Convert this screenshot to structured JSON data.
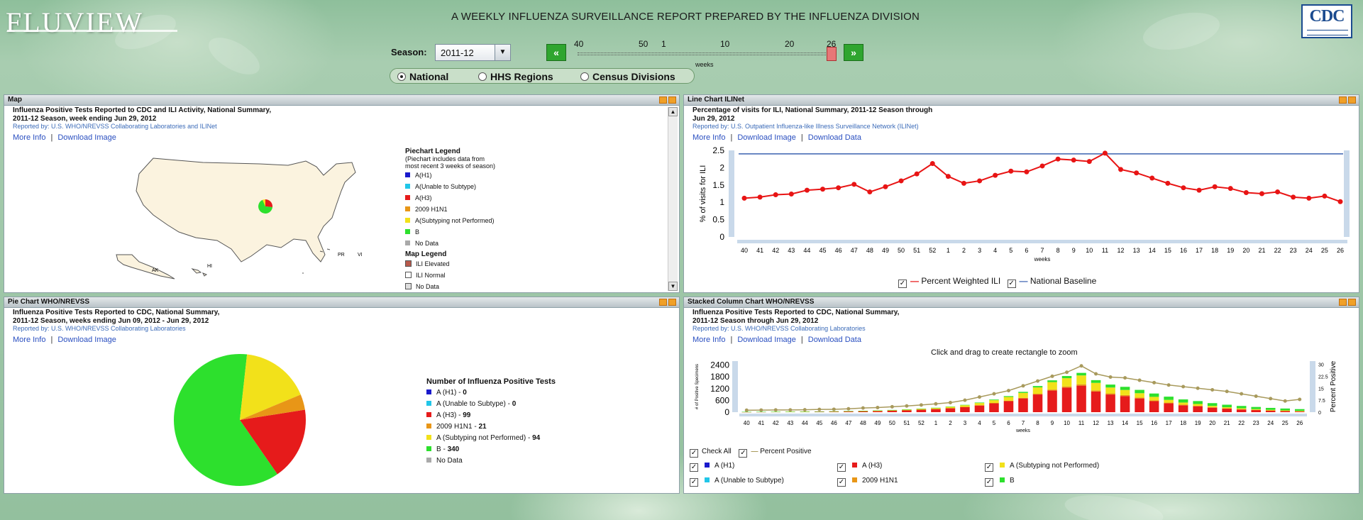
{
  "header": {
    "logo": "FLUVIEW",
    "tagline": "A WEEKLY INFLUENZA SURVEILLANCE REPORT PREPARED BY THE INFLUENZA DIVISION",
    "cdc_logo": "CDC"
  },
  "controls": {
    "season_label": "Season:",
    "season_value": "2011-12",
    "season_arrow": "▼",
    "prev_label": "«",
    "next_label": "»",
    "slider_numbers": [
      "40",
      "50",
      "1",
      "10",
      "20",
      "26"
    ],
    "slider_caption": "weeks",
    "geo_options": [
      "National",
      "HHS Regions",
      "Census Divisions"
    ],
    "geo_selected": "National"
  },
  "map_panel": {
    "header": "Map",
    "title1": "Influenza Positive Tests Reported to CDC and ILI Activity,  National Summary,",
    "title2": "2011-12 Season, week ending  Jun 29, 2012",
    "reported_by": "Reported by: U.S. WHO/NREVSS Collaborating Laboratories and ILINet",
    "link_more": "More Info",
    "link_sep": "|",
    "link_download": "Download Image",
    "state_labels": [
      "AK",
      "HI",
      "PR",
      "VI"
    ],
    "legend_title": "Piechart Legend",
    "legend_note1": "(Piechart includes data from",
    "legend_note2": "most recent 3 weeks of season)",
    "legend_items": [
      {
        "label": "A(H1)",
        "color": "#1a1acc"
      },
      {
        "label": "A(Unable to Subtype)",
        "color": "#21c6e8"
      },
      {
        "label": "A(H3)",
        "color": "#e61b1b"
      },
      {
        "label": "2009 H1N1",
        "color": "#e89617"
      },
      {
        "label": "A(Subtyping not Performed)",
        "color": "#f2e11a"
      },
      {
        "label": "B",
        "color": "#2de02d"
      },
      {
        "label": "No Data",
        "color": "#a9a9a9"
      }
    ],
    "map_legend_title": "Map Legend",
    "map_legend_items": [
      {
        "label": "ILI Elevated",
        "color": "#b85a4c"
      },
      {
        "label": "ILI Normal",
        "color": "#ffffff"
      },
      {
        "label": "No Data",
        "color": "#dddddd"
      }
    ],
    "scroll_up": "▲",
    "scroll_down": "▼"
  },
  "line_panel": {
    "header": "Line Chart ILINet",
    "title1": "Percentage of visits for ILI,  National Summary,  2011-12 Season through",
    "title2": "Jun 29, 2012",
    "reported_by": "Reported by: U.S. Outpatient Influenza-like Illness Surveillance Network (ILINet)",
    "link_more": "More Info",
    "link_sep": "|",
    "link_download": "Download Image",
    "link_data": "Download Data",
    "legend_ili": "Percent Weighted ILI",
    "legend_baseline": "National Baseline",
    "check_mark": "✓",
    "line_colors": {
      "ili": "#e81414",
      "baseline": "#3b62b0"
    }
  },
  "pie_panel": {
    "header": "Pie Chart WHO/NREVSS",
    "title1": "Influenza Positive Tests Reported to CDC,  National Summary,",
    "title2": "2011-12 Season, weeks ending  Jun 09, 2012 - Jun 29, 2012",
    "reported_by": "Reported by: U.S. WHO/NREVSS Collaborating Laboratories",
    "link_more": "More Info",
    "link_sep": "|",
    "link_download": "Download Image",
    "legend_title": "Number of Influenza Positive Tests",
    "legend_items": [
      {
        "label": "A (H1) - ",
        "value": "0",
        "color": "#1a1acc"
      },
      {
        "label": "A (Unable to Subtype) - ",
        "value": "0",
        "color": "#21c6e8"
      },
      {
        "label": "A (H3) - ",
        "value": "99",
        "color": "#e61b1b"
      },
      {
        "label": "2009 H1N1 - ",
        "value": "21",
        "color": "#e89617"
      },
      {
        "label": "A (Subtyping not Performed) - ",
        "value": "94",
        "color": "#f2e11a"
      },
      {
        "label": "B - ",
        "value": "340",
        "color": "#2de02d"
      },
      {
        "label": "No Data",
        "value": "",
        "color": "#a9a9a9"
      }
    ]
  },
  "stacked_panel": {
    "header": "Stacked Column Chart WHO/NREVSS",
    "title1": "Influenza Positive Tests Reported to CDC,  National Summary,",
    "title2": "2011-12 Season through  Jun 29, 2012",
    "reported_by": "Reported by: U.S. WHO/NREVSS Collaborating Laboratories",
    "link_more": "More Info",
    "link_sep": "|",
    "link_download": "Download Image",
    "link_data": "Download Data",
    "zoom_hint": "Click and drag to create rectangle to zoom",
    "check_all": "Check All",
    "percent_positive": "Percent Positive",
    "check_mark": "✓",
    "checks": [
      {
        "label": "A (H1)",
        "color": "#1a1acc"
      },
      {
        "label": "A (H3)",
        "color": "#e61b1b"
      },
      {
        "label": "A (Subtyping not Performed)",
        "color": "#f2e11a"
      },
      {
        "label": "A (Unable to Subtype)",
        "color": "#21c6e8"
      },
      {
        "label": "2009 H1N1",
        "color": "#e89617"
      },
      {
        "label": "B",
        "color": "#2de02d"
      }
    ]
  },
  "chart_data": [
    {
      "type": "line",
      "title": "Percentage of visits for ILI,  National Summary,  2011-12 Season through Jun 29, 2012",
      "xlabel": "weeks",
      "ylabel": "% of visits for ILI",
      "ylim": [
        0,
        2.5
      ],
      "yticks": [
        "0",
        "0.5",
        "1",
        "1.5",
        "2",
        "2.5"
      ],
      "x": [
        "40",
        "41",
        "42",
        "43",
        "44",
        "45",
        "46",
        "47",
        "48",
        "49",
        "50",
        "51",
        "52",
        "1",
        "2",
        "3",
        "4",
        "5",
        "6",
        "7",
        "8",
        "9",
        "10",
        "11",
        "12",
        "13",
        "14",
        "15",
        "16",
        "17",
        "18",
        "19",
        "20",
        "21",
        "22",
        "23",
        "24",
        "25",
        "26"
      ],
      "series": [
        {
          "name": "Percent Weighted ILI",
          "values": [
            1.12,
            1.15,
            1.22,
            1.24,
            1.35,
            1.38,
            1.42,
            1.52,
            1.3,
            1.45,
            1.62,
            1.82,
            2.12,
            1.75,
            1.55,
            1.62,
            1.78,
            1.9,
            1.88,
            2.05,
            2.25,
            2.22,
            2.18,
            2.42,
            1.95,
            1.85,
            1.7,
            1.55,
            1.42,
            1.35,
            1.45,
            1.4,
            1.28,
            1.25,
            1.3,
            1.15,
            1.12,
            1.18,
            1.02
          ]
        },
        {
          "name": "National Baseline",
          "values": [
            2.4,
            2.4,
            2.4,
            2.4,
            2.4,
            2.4,
            2.4,
            2.4,
            2.4,
            2.4,
            2.4,
            2.4,
            2.4,
            2.4,
            2.4,
            2.4,
            2.4,
            2.4,
            2.4,
            2.4,
            2.4,
            2.4,
            2.4,
            2.4,
            2.4,
            2.4,
            2.4,
            2.4,
            2.4,
            2.4,
            2.4,
            2.4,
            2.4,
            2.4,
            2.4,
            2.4,
            2.4,
            2.4,
            2.4
          ]
        }
      ],
      "grid": false,
      "legend": "bottom"
    },
    {
      "type": "pie",
      "title": "Number of Influenza Positive Tests",
      "categories": [
        "A (H1)",
        "A (Unable to Subtype)",
        "A (H3)",
        "2009 H1N1",
        "A (Subtyping not Performed)",
        "B"
      ],
      "values": [
        0,
        0,
        99,
        21,
        94,
        340
      ],
      "colors": [
        "#1a1acc",
        "#21c6e8",
        "#e61b1b",
        "#e89617",
        "#f2e11a",
        "#2de02d"
      ]
    },
    {
      "type": "bar",
      "stacked": true,
      "title": "Influenza Positive Tests Reported to CDC, National Summary, 2011-12 Season through Jun 29, 2012",
      "xlabel": "weeks",
      "ylabel": "# of Positive Specimens",
      "y2label": "Percent Positive",
      "ylim": [
        0,
        2600
      ],
      "yticks": [
        "0",
        "600",
        "1200",
        "1800",
        "2400"
      ],
      "y2lim": [
        0,
        32
      ],
      "y2ticks": [
        "0",
        "7.5",
        "15",
        "22.5",
        "30"
      ],
      "categories": [
        "40",
        "41",
        "42",
        "43",
        "44",
        "45",
        "46",
        "47",
        "48",
        "49",
        "50",
        "51",
        "52",
        "1",
        "2",
        "3",
        "4",
        "5",
        "6",
        "7",
        "8",
        "9",
        "10",
        "11",
        "12",
        "13",
        "14",
        "15",
        "16",
        "17",
        "18",
        "19",
        "20",
        "21",
        "22",
        "23",
        "24",
        "25",
        "26"
      ],
      "series": [
        {
          "name": "A (H1)",
          "color": "#1a1acc",
          "values": [
            0,
            0,
            0,
            0,
            0,
            0,
            0,
            0,
            0,
            0,
            0,
            0,
            0,
            0,
            0,
            0,
            0,
            0,
            0,
            0,
            0,
            0,
            0,
            0,
            0,
            0,
            0,
            0,
            0,
            0,
            0,
            0,
            0,
            0,
            0,
            0,
            0,
            0,
            0
          ]
        },
        {
          "name": "A (Unable to Subtype)",
          "color": "#21c6e8",
          "values": [
            0,
            0,
            0,
            0,
            0,
            0,
            0,
            0,
            0,
            0,
            0,
            0,
            0,
            0,
            0,
            0,
            0,
            0,
            0,
            0,
            0,
            0,
            0,
            0,
            0,
            0,
            0,
            0,
            0,
            0,
            0,
            0,
            0,
            0,
            0,
            0,
            0,
            0,
            0
          ]
        },
        {
          "name": "A (H3)",
          "color": "#e61b1b",
          "values": [
            10,
            12,
            15,
            18,
            20,
            25,
            30,
            40,
            50,
            60,
            80,
            100,
            130,
            160,
            200,
            260,
            340,
            450,
            560,
            700,
            900,
            1100,
            1250,
            1350,
            1050,
            900,
            820,
            700,
            560,
            450,
            350,
            300,
            230,
            180,
            140,
            110,
            80,
            60,
            40
          ]
        },
        {
          "name": "2009 H1N1",
          "color": "#e89617",
          "values": [
            0,
            0,
            0,
            0,
            0,
            0,
            0,
            2,
            2,
            3,
            4,
            5,
            6,
            8,
            10,
            12,
            15,
            20,
            25,
            30,
            40,
            50,
            60,
            70,
            60,
            55,
            50,
            45,
            40,
            35,
            30,
            25,
            20,
            15,
            12,
            10,
            8,
            6,
            5
          ]
        },
        {
          "name": "A (Subtyping not Performed)",
          "color": "#f2e11a",
          "values": [
            5,
            5,
            5,
            6,
            6,
            8,
            10,
            12,
            15,
            18,
            22,
            28,
            35,
            45,
            60,
            80,
            110,
            140,
            190,
            250,
            320,
            380,
            420,
            450,
            380,
            300,
            260,
            220,
            180,
            140,
            110,
            90,
            70,
            55,
            45,
            35,
            30,
            25,
            20
          ]
        },
        {
          "name": "B",
          "color": "#2de02d",
          "values": [
            2,
            2,
            2,
            3,
            3,
            3,
            4,
            4,
            5,
            6,
            7,
            8,
            10,
            12,
            15,
            20,
            25,
            32,
            42,
            55,
            70,
            90,
            110,
            130,
            140,
            150,
            160,
            170,
            170,
            165,
            160,
            150,
            140,
            130,
            120,
            110,
            100,
            95,
            90
          ]
        },
        {
          "name": "Percent Positive",
          "color": "#a89a5c",
          "y2_values": [
            1.2,
            1.3,
            1.4,
            1.4,
            1.5,
            1.7,
            1.8,
            2.1,
            2.6,
            2.9,
            3.4,
            3.9,
            4.5,
            5.2,
            6.0,
            7.5,
            9.5,
            11.5,
            13.5,
            16.5,
            19.5,
            22.5,
            25.0,
            29.0,
            24.0,
            22.0,
            21.5,
            20.0,
            18.5,
            17.0,
            16.0,
            15.0,
            14.0,
            13.0,
            11.5,
            10.0,
            8.5,
            7.0,
            8.0
          ]
        }
      ],
      "legend": "bottom"
    }
  ]
}
